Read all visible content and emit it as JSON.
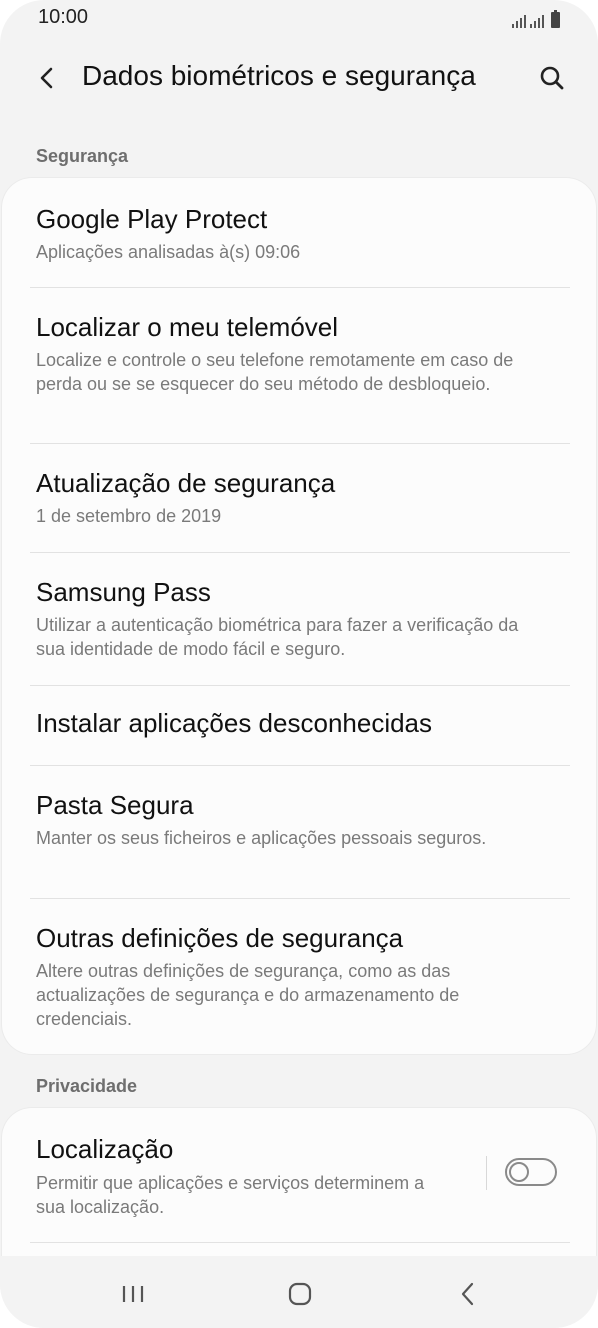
{
  "status_bar": {
    "time": "10:00"
  },
  "header": {
    "title": "Dados biométricos e segurança",
    "back_icon": "chevron-left-icon",
    "search_icon": "search-icon"
  },
  "sections": [
    {
      "label": "Segurança",
      "items": [
        {
          "title": "Google Play Protect",
          "subtitle": "Aplicações analisadas à(s) 09:06"
        },
        {
          "title": "Localizar o meu telemóvel",
          "subtitle": "Localize e controle o seu telefone remotamente em caso de perda ou se se esquecer do seu método de desbloqueio."
        },
        {
          "title": "Atualização de segurança",
          "subtitle": "1 de setembro de 2019"
        },
        {
          "title": "Samsung Pass",
          "subtitle": "Utilizar a autenticação biométrica para fazer a verificação da sua identidade de modo fácil e seguro."
        },
        {
          "title": "Instalar aplicações desconhecidas"
        },
        {
          "title": "Pasta Segura",
          "subtitle": "Manter os seus ficheiros e aplicações pessoais seguros."
        },
        {
          "title": "Outras definições de segurança",
          "subtitle": "Altere outras definições de segurança, como as das actualizações de segurança e do armazenamento de credenciais."
        }
      ]
    },
    {
      "label": "Privacidade",
      "items": [
        {
          "title": "Localização",
          "subtitle": "Permitir que aplicações e serviços determinem a sua localização.",
          "toggle": false
        }
      ]
    }
  ],
  "nav_bar": {
    "recents_icon": "recent-apps-icon",
    "home_icon": "home-icon",
    "back_icon": "back-icon"
  },
  "colors": {
    "background": "#f3f3f3",
    "card": "#fcfcfc",
    "title_text": "#111111",
    "subtitle_text": "#7a7a7a",
    "section_text": "#6e6e6e"
  }
}
